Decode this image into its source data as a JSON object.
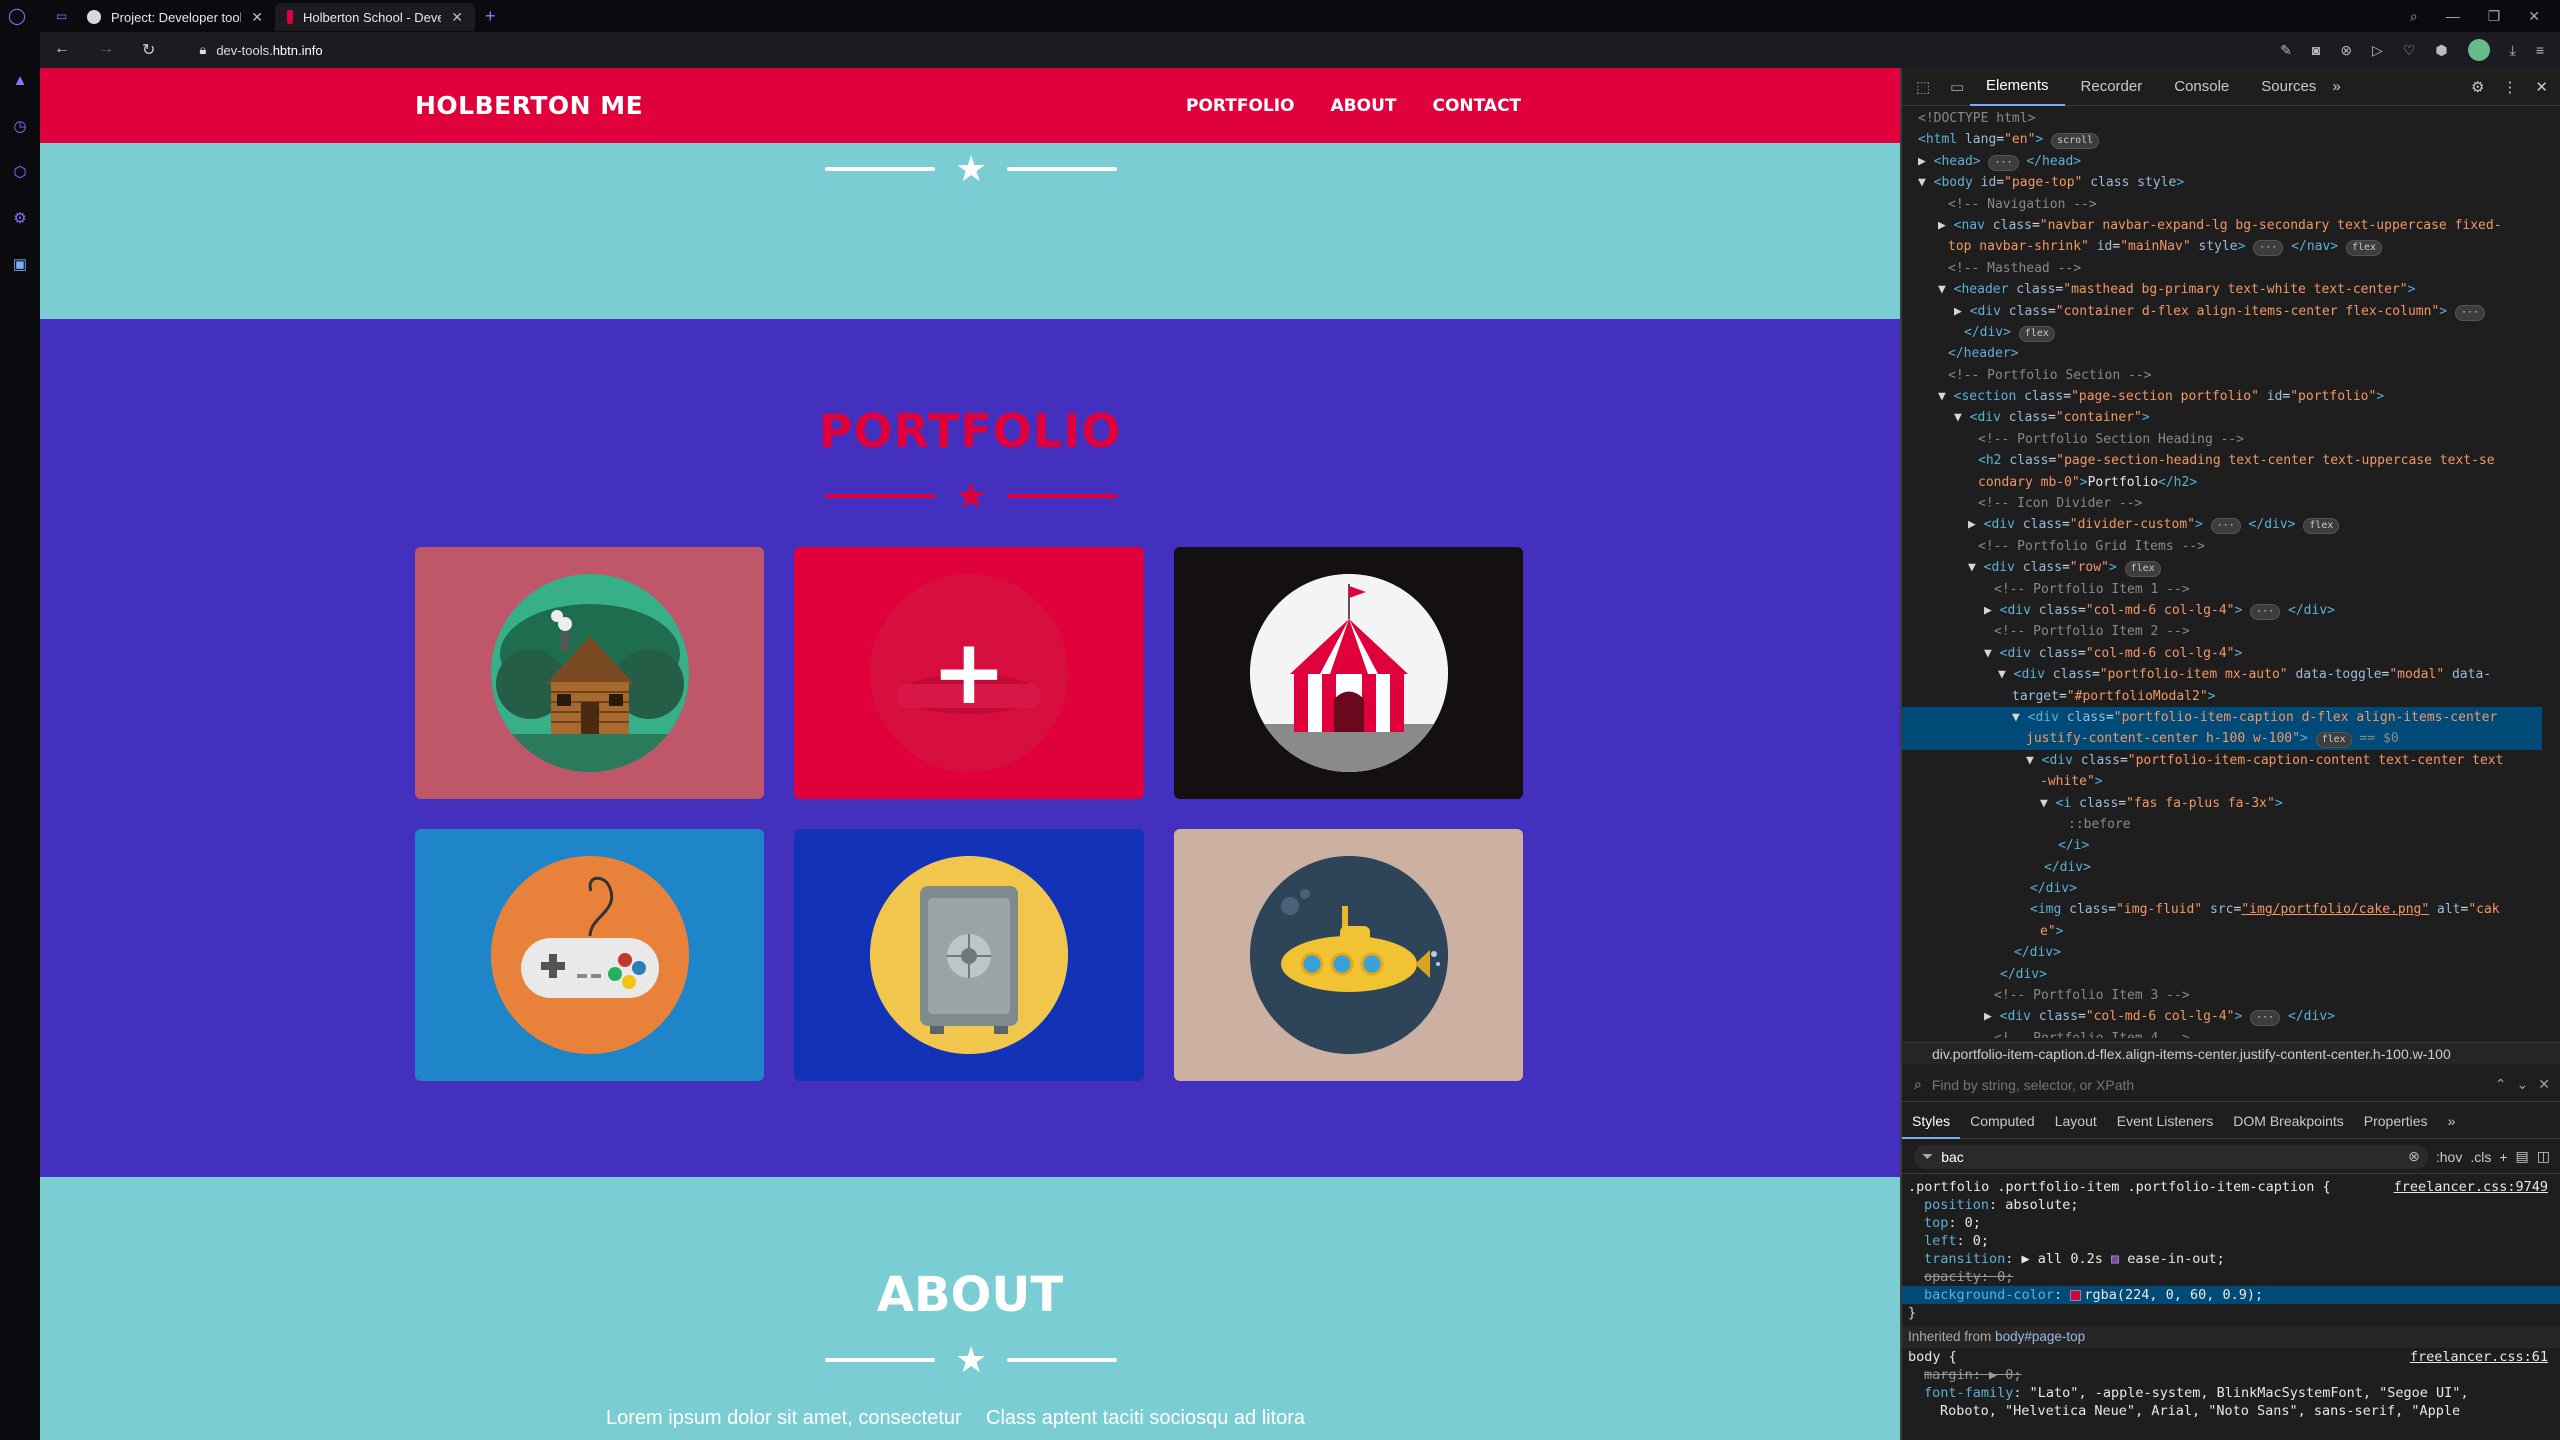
{
  "browser": {
    "tabs": [
      {
        "title": "Project: Developer tools | A"
      },
      {
        "title": "Holberton School - Develo"
      }
    ],
    "url_prefix": "dev-tools.",
    "url_host": "hbtn.info"
  },
  "site": {
    "brand": "HOLBERTON ME",
    "nav": [
      "PORTFOLIO",
      "ABOUT",
      "CONTACT"
    ],
    "portfolio_title": "PORTFOLIO",
    "about_title": "ABOUT",
    "about_text_left": "Lorem ipsum dolor sit amet, consectetur",
    "about_text_right": "Class aptent taciti sociosqu ad litora",
    "colors": {
      "primary": "#e0003c",
      "secondary": "#4430bf",
      "teal": "#7acdd2"
    },
    "portfolio_items": [
      {
        "icon": "cabin-icon",
        "bg": "#c0566a"
      },
      {
        "icon": "cake-icon",
        "bg": "#e0003c"
      },
      {
        "icon": "circus-tent-icon",
        "bg": "#140f10"
      },
      {
        "icon": "game-controller-icon",
        "bg": "#1f85c9"
      },
      {
        "icon": "safe-icon",
        "bg": "#1232b8"
      },
      {
        "icon": "submarine-icon",
        "bg": "#ccb1a2"
      }
    ]
  },
  "devtools": {
    "tabs": [
      "Elements",
      "Recorder",
      "Console",
      "Sources"
    ],
    "breadcrumb": "div.portfolio-item-caption.d-flex.align-items-center.justify-content-center.h-100.w-100",
    "find_placeholder": "Find by string, selector, or XPath",
    "style_tabs": [
      "Styles",
      "Computed",
      "Layout",
      "Event Listeners",
      "DOM Breakpoints",
      "Properties"
    ],
    "filter_value": "bac",
    "hov": ":hov",
    "cls": ".cls",
    "rule_selector": ".portfolio .portfolio-item .portfolio-item-caption {",
    "rule_source": "freelancer.css:9749",
    "inherited_label": "Inherited from",
    "inherited_from": "body#page-top",
    "body_selector": "body {",
    "body_source": "freelancer.css:61"
  }
}
